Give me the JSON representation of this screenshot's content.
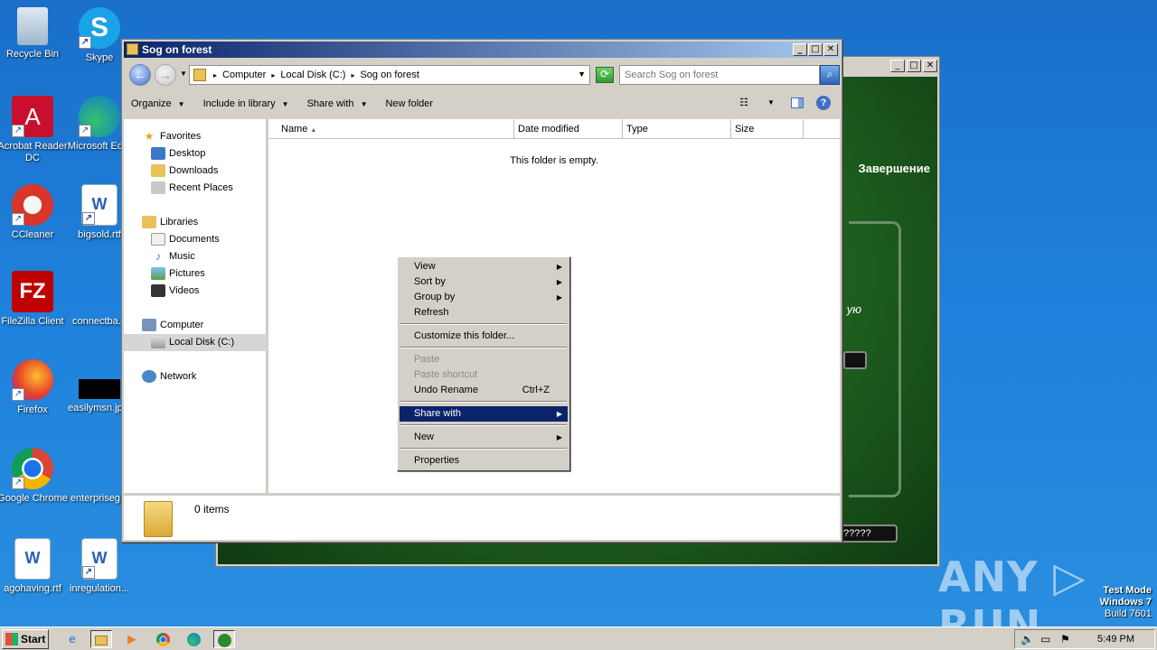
{
  "desktop": {
    "icons": [
      {
        "label": "Recycle Bin",
        "icon": "recycle-bin-icon"
      },
      {
        "label": "Skype",
        "icon": "skype-icon"
      },
      {
        "label": "Acrobat Reader DC",
        "icon": "acrobat-icon"
      },
      {
        "label": "Microsoft Ed...",
        "icon": "edge-icon"
      },
      {
        "label": "CCleaner",
        "icon": "ccleaner-icon"
      },
      {
        "label": "bigsold.rtf",
        "icon": "word-doc-icon"
      },
      {
        "label": "FileZilla Client",
        "icon": "filezilla-icon"
      },
      {
        "label": "connectba...",
        "icon": "file-icon"
      },
      {
        "label": "Firefox",
        "icon": "firefox-icon"
      },
      {
        "label": "easilymsn.jp...",
        "icon": "image-file-icon"
      },
      {
        "label": "Google Chrome",
        "icon": "chrome-icon"
      },
      {
        "label": "enterpriseg...",
        "icon": "file-icon"
      },
      {
        "label": "agohaving.rtf",
        "icon": "word-doc-icon"
      },
      {
        "label": "inregulation...",
        "icon": "word-doc-icon"
      }
    ]
  },
  "bg_window": {
    "label_finish": "Завершение",
    "label_partial": "ую",
    "field_text": "?????"
  },
  "explorer": {
    "title": "Sog on forest",
    "breadcrumbs": [
      "Computer",
      "Local Disk (C:)",
      "Sog on forest"
    ],
    "search_placeholder": "Search Sog on forest",
    "commands": {
      "organize": "Organize",
      "include_library": "Include in library",
      "share_with": "Share with",
      "new_folder": "New folder"
    },
    "nav": {
      "favorites": "Favorites",
      "desktop": "Desktop",
      "downloads": "Downloads",
      "recent_places": "Recent Places",
      "libraries": "Libraries",
      "documents": "Documents",
      "music": "Music",
      "pictures": "Pictures",
      "videos": "Videos",
      "computer": "Computer",
      "local_disk": "Local Disk (C:)",
      "network": "Network"
    },
    "columns": {
      "name": "Name",
      "date_modified": "Date modified",
      "type": "Type",
      "size": "Size"
    },
    "empty_text": "This folder is empty.",
    "status_items": "0 items"
  },
  "context_menu": {
    "view": "View",
    "sort_by": "Sort by",
    "group_by": "Group by",
    "refresh": "Refresh",
    "customize": "Customize this folder...",
    "paste": "Paste",
    "paste_shortcut": "Paste shortcut",
    "undo_rename": "Undo Rename",
    "undo_shortcut": "Ctrl+Z",
    "share_with": "Share with",
    "new": "New",
    "properties": "Properties"
  },
  "watermark": {
    "brand": "ANY ▷ RUN",
    "test_mode": "Test Mode",
    "os": "Windows 7",
    "build": "Build 7601"
  },
  "taskbar": {
    "start_label": "Start",
    "clock": "5:49 PM"
  }
}
